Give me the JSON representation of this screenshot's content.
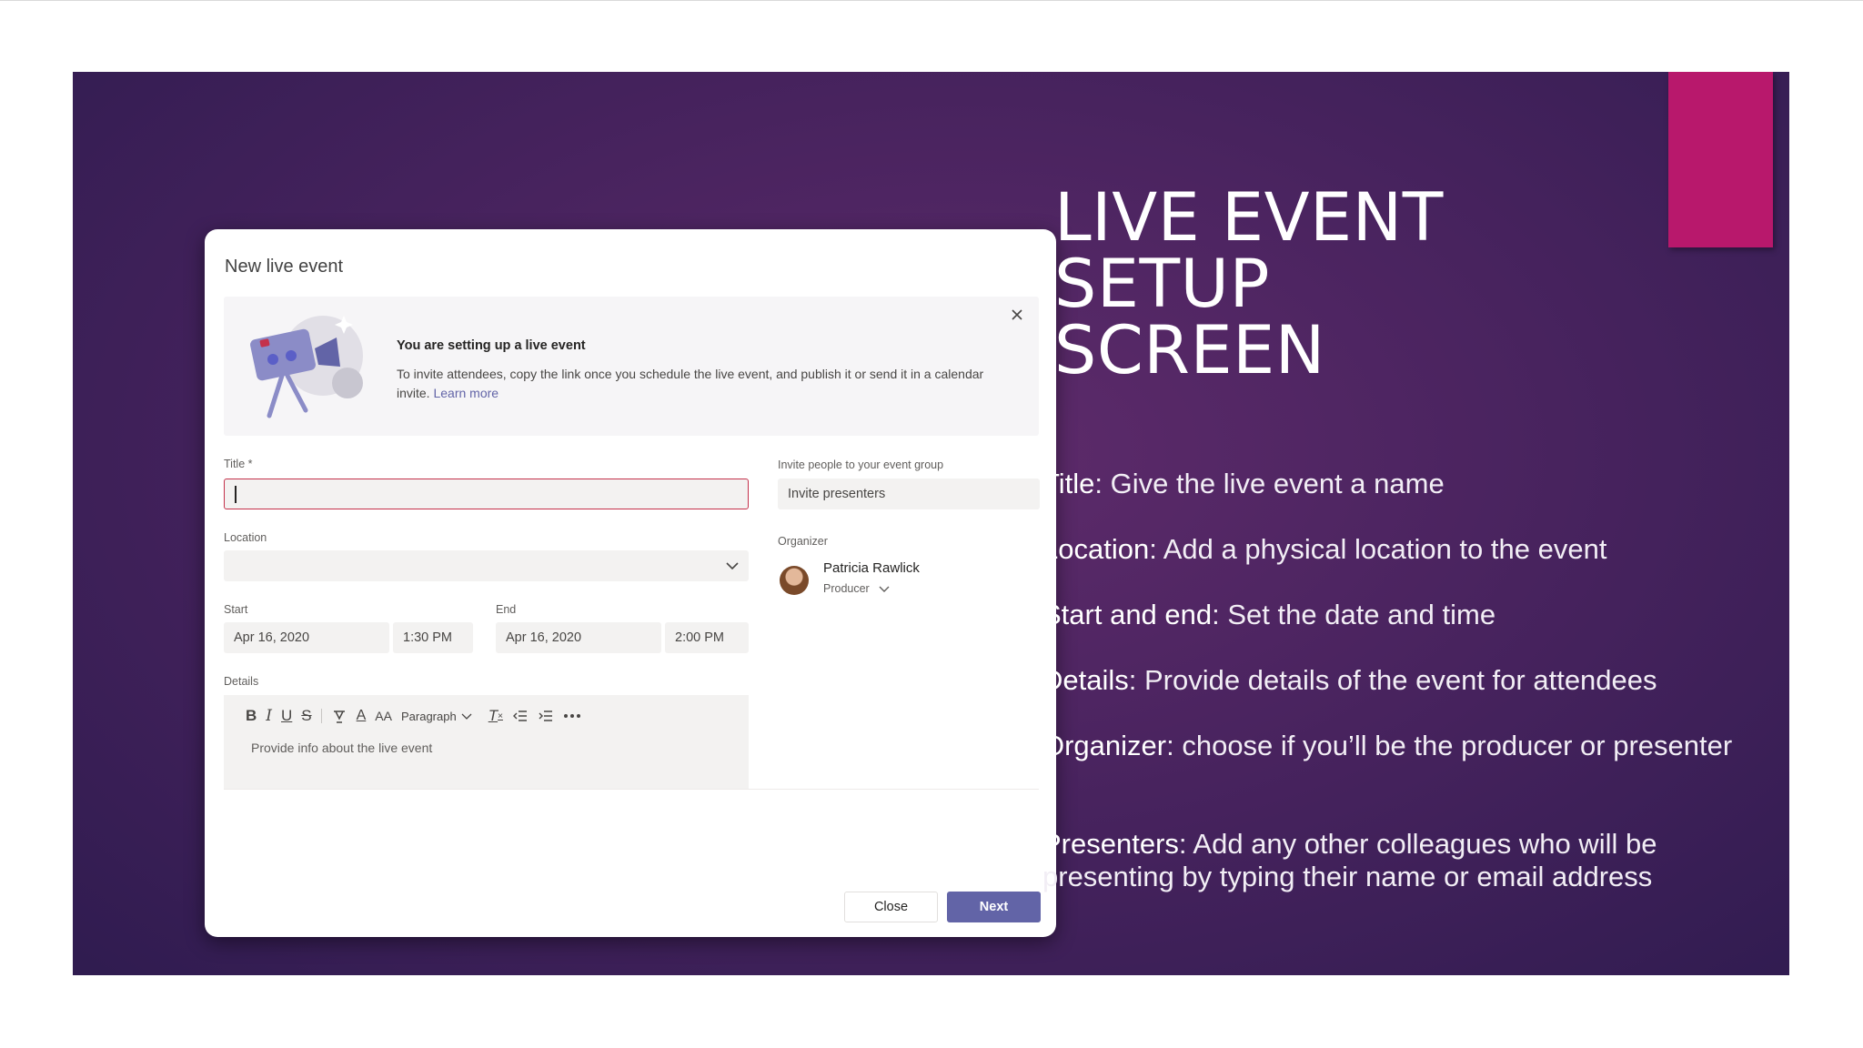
{
  "slide": {
    "heading_lines": [
      "LIVE EVENT",
      "SETUP",
      "SCREEN"
    ],
    "bullets": [
      {
        "key": "Title",
        "text": ": Give the live event a name"
      },
      {
        "key": "Location",
        "text": ": Add a physical location to the event"
      },
      {
        "key": "Start and end",
        "text": ": Set the date and time"
      },
      {
        "key": "Details",
        "text": ": Provide details of the event for attendees"
      },
      {
        "key": "Organizer",
        "text": ": choose if you’ll be the producer or presenter"
      },
      {
        "key": "Presenters",
        "text": ": Add any other colleagues who will be presenting by typing their name or email address"
      }
    ],
    "colors": {
      "background": "#4b2460",
      "accent": "#b8186c"
    }
  },
  "dialog": {
    "title": "New live event",
    "banner": {
      "heading": "You are setting up a live event",
      "text": "To invite attendees, copy the link once you schedule the live event, and publish it or send it in a calendar invite.",
      "link": "Learn more",
      "close_icon": "close-icon",
      "illustration": "video-camera-illustration"
    },
    "form": {
      "title_label": "Title *",
      "title_value": "",
      "location_label": "Location",
      "location_value": "",
      "start_label": "Start",
      "start_date": "Apr 16, 2020",
      "start_time": "1:30 PM",
      "end_label": "End",
      "end_date": "Apr 16, 2020",
      "end_time": "2:00 PM",
      "details_label": "Details",
      "details_placeholder": "Provide info about the live event",
      "toolbar": {
        "bold": "B",
        "italic": "I",
        "underline": "U",
        "strike": "S",
        "highlight": "highlight-icon",
        "font_color": "A",
        "font_size": "AA",
        "paragraph": "Paragraph",
        "clear_format": "T",
        "outdent": "outdent-icon",
        "indent": "indent-icon",
        "more": "more-icon"
      },
      "invite_label": "Invite people to your event group",
      "invite_placeholder": "Invite presenters",
      "organizer_label": "Organizer",
      "organizer_name": "Patricia Rawlick",
      "organizer_role": "Producer"
    },
    "buttons": {
      "close": "Close",
      "next": "Next"
    },
    "colors": {
      "primary": "#6264a7",
      "error_border": "#c4314b"
    }
  }
}
